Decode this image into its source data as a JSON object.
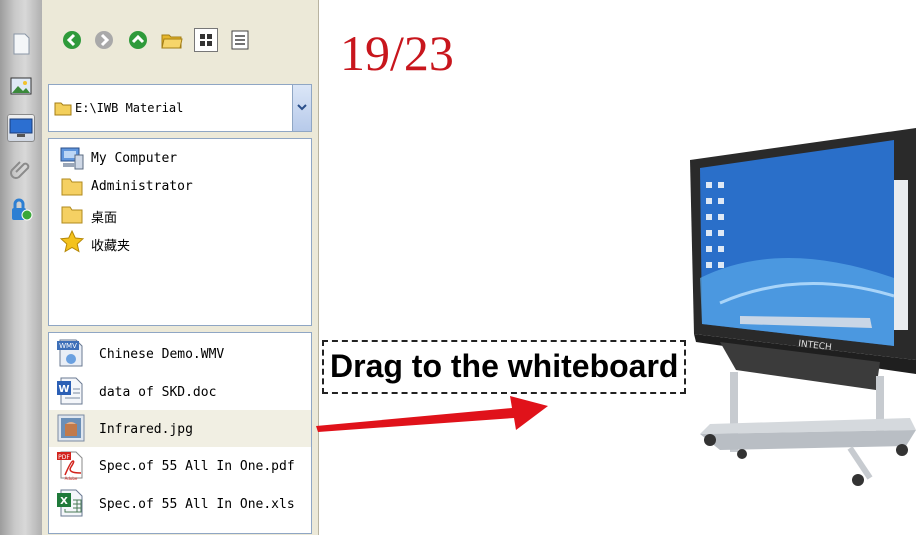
{
  "toolbar": {
    "buttons": [
      {
        "name": "back-button",
        "icon": "arrow-left-icon",
        "color": "#2e9a3a"
      },
      {
        "name": "forward-button",
        "icon": "arrow-right-icon",
        "color": "#9a9a9a"
      },
      {
        "name": "up-button",
        "icon": "arrow-up-icon",
        "color": "#2e9a3a"
      },
      {
        "name": "new-folder-button",
        "icon": "folder-open-icon",
        "color": "#e6b62c"
      },
      {
        "name": "thumbnail-view-button",
        "icon": "grid-view-icon",
        "color": "#333333"
      },
      {
        "name": "list-view-button",
        "icon": "list-view-icon",
        "color": "#333333"
      }
    ]
  },
  "path": {
    "value": "E:\\IWB Material"
  },
  "tree": {
    "items": [
      {
        "label": "My Computer",
        "icon": "computer-icon"
      },
      {
        "label": "Administrator",
        "icon": "folder-icon"
      },
      {
        "label": "桌面",
        "icon": "folder-icon"
      },
      {
        "label": "收藏夹",
        "icon": "star-icon"
      }
    ]
  },
  "files": {
    "items": [
      {
        "label": "Chinese Demo.WMV",
        "icon": "wmv-file-icon",
        "badge": "WMV"
      },
      {
        "label": "data of SKD.doc",
        "icon": "word-file-icon",
        "badge": "W"
      },
      {
        "label": "Infrared.jpg",
        "icon": "image-file-icon",
        "selected": true
      },
      {
        "label": "Spec.of 55 All In One.pdf",
        "icon": "pdf-file-icon",
        "badge": "PDF",
        "sub": "Adobe"
      },
      {
        "label": "Spec.of 55 All In One.xls",
        "icon": "excel-file-icon",
        "badge": "X"
      }
    ]
  },
  "canvas": {
    "page_counter": "19/23",
    "caption": "Drag to the whiteboard",
    "board_brand": "INTECH",
    "accent": "#c8161d",
    "arrow_color": "#e0121a"
  }
}
